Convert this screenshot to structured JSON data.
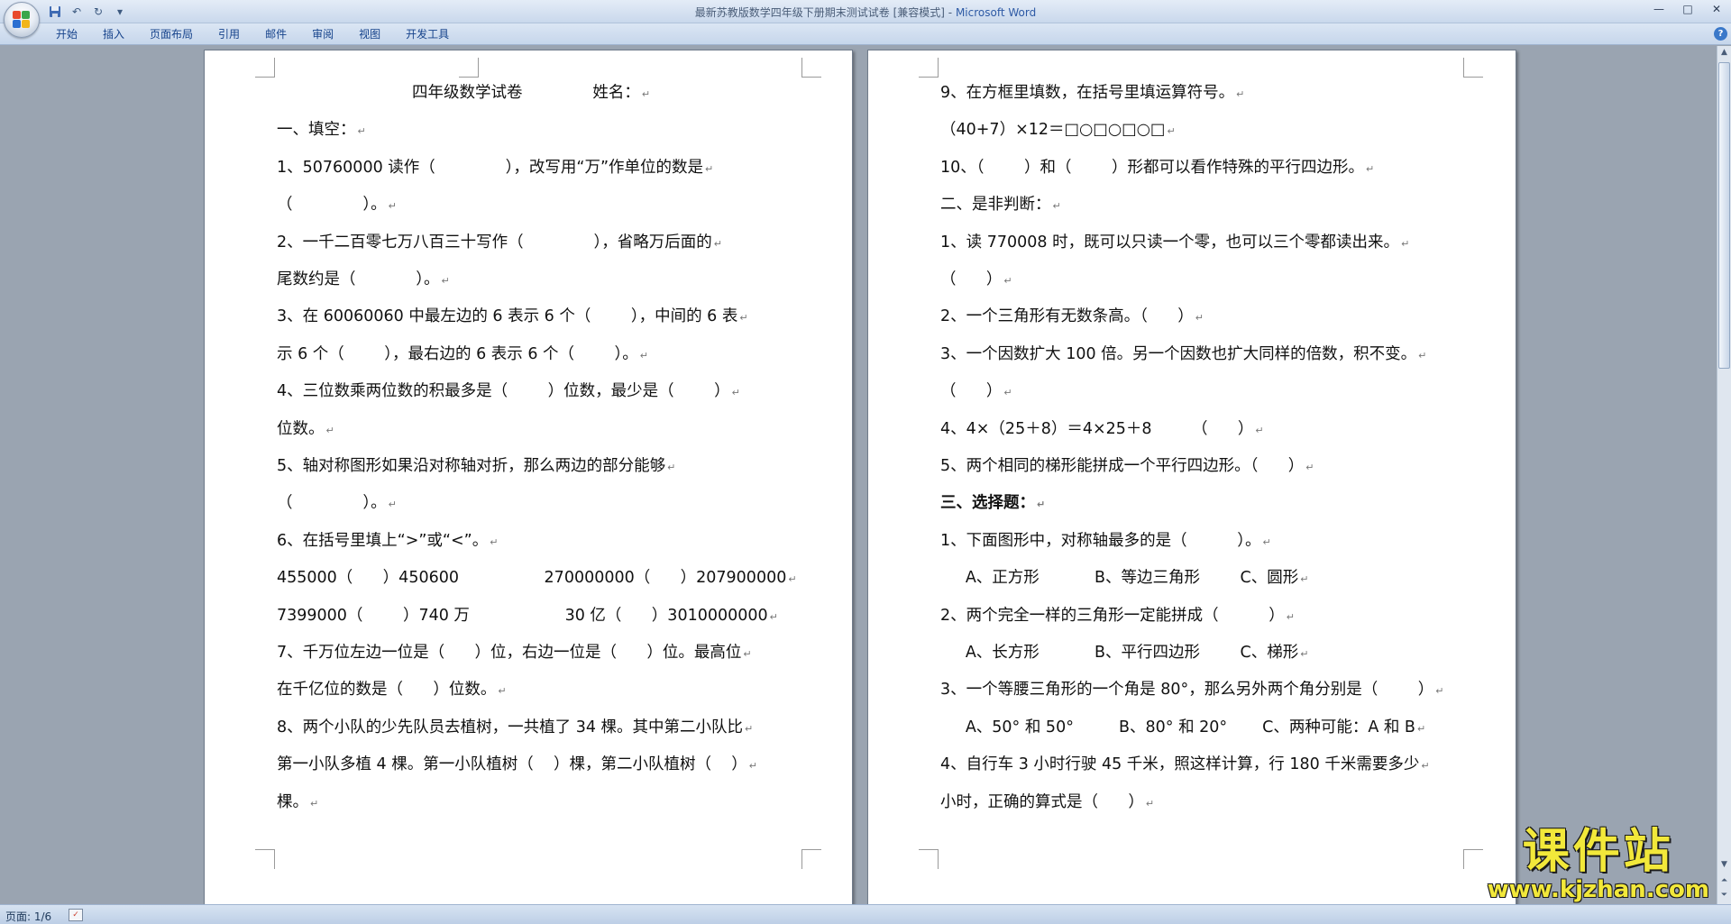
{
  "window": {
    "title": "最新苏教版数学四年级下册期末测试试卷 [兼容模式]",
    "title_separator": " - ",
    "app_name": "Microsoft Word",
    "controls": {
      "minimize": "—",
      "maximize": "□",
      "close": "✕"
    }
  },
  "quick_access": {
    "save_icon": "save-icon",
    "undo_glyph": "↶",
    "redo_glyph": "↻",
    "customize_glyph": "▾"
  },
  "ribbon": {
    "tabs": [
      "开始",
      "插入",
      "页面布局",
      "引用",
      "邮件",
      "审阅",
      "视图",
      "开发工具"
    ],
    "help_glyph": "?"
  },
  "page1": {
    "lines": [
      "四年级数学试卷              姓名：",
      "一、填空：",
      "1、50760000 读作（              ），改写用“万”作单位的数是",
      "（              ）。",
      "2、一千二百零七万八百三十写作（              ），省略万后面的",
      "尾数约是（            ）。",
      "3、在 60060060 中最左边的 6 表示 6 个（        ），中间的 6 表",
      "示 6 个（        ），最右边的 6 表示 6 个（        ）。",
      "4、三位数乘两位数的积最多是（        ）位数，最少是（        ）",
      "位数。",
      "5、轴对称图形如果沿对称轴对折，那么两边的部分能够",
      "（              ）。",
      "6、在括号里填上“>”或“<”。",
      "455000（      ）450600                 270000000（      ）207900000",
      "7399000（        ）740 万                   30 亿（      ）3010000000",
      "7、千万位左边一位是（      ）位，右边一位是（      ）位。最高位",
      "在千亿位的数是（      ）位数。",
      "8、两个小队的少先队员去植树，一共植了 34 棵。其中第二小队比",
      "第一小队多植 4 棵。第一小队植树（    ）棵，第二小队植树（    ）",
      "棵。"
    ]
  },
  "page2": {
    "lines": [
      "9、在方框里填数，在括号里填运算符号。",
      "（40+7）×12＝□○□○□○□",
      "10、（        ）和（        ）形都可以看作特殊的平行四边形。",
      "二、是非判断：",
      "1、读 770008 时，既可以只读一个零，也可以三个零都读出来。",
      "（      ）",
      "2、一个三角形有无数条高。（      ）",
      "3、一个因数扩大 100 倍。另一个因数也扩大同样的倍数，积不变。",
      "（      ）",
      "4、4×（25＋8）＝4×25＋8        （      ）",
      "5、两个相同的梯形能拼成一个平行四边形。（      ）",
      "三、选择题：",
      "1、下面图形中，对称轴最多的是（          ）。",
      "     A、正方形           B、等边三角形        C、圆形",
      "2、两个完全一样的三角形一定能拼成（          ）",
      "     A、长方形           B、平行四边形        C、梯形",
      "3、一个等腰三角形的一个角是 80°，那么另外两个角分别是（        ）",
      "     A、50° 和 50°         B、80° 和 20°       C、两种可能：A 和 B",
      "4、自行车 3 小时行驶 45 千米，照这样计算，行 180 千米需要多少",
      "小时，正确的算式是（      ）"
    ]
  },
  "paragraph_mark": "↵",
  "statusbar": {
    "page": "页面: 1/6"
  },
  "watermark": {
    "title": "课件站",
    "url": "www.kjzhan.com"
  },
  "colors": {
    "title_app": "#2e5aa5",
    "tab_text": "#15428b",
    "watermark": "#f2e83a"
  }
}
